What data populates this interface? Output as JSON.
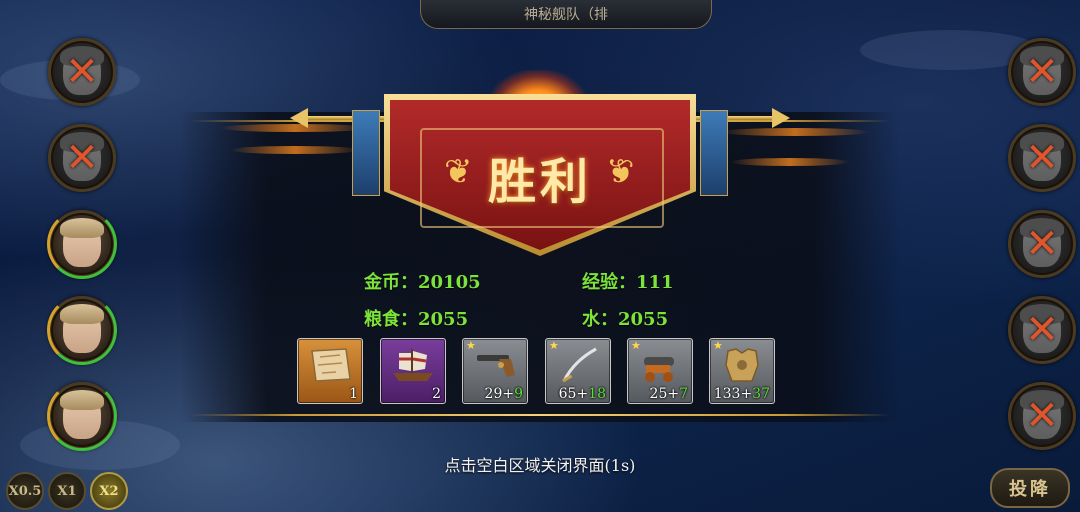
{
  "header": {
    "title": "神秘舰队（排"
  },
  "left_fleet": [
    {
      "status": "defeated",
      "mark": "✕"
    },
    {
      "status": "defeated",
      "mark": "✕"
    },
    {
      "status": "alive",
      "mark": ""
    },
    {
      "status": "alive",
      "mark": ""
    },
    {
      "status": "alive",
      "mark": ""
    }
  ],
  "right_fleet": [
    {
      "status": "defeated",
      "mark": "✕"
    },
    {
      "status": "defeated",
      "mark": "✕"
    },
    {
      "status": "defeated",
      "mark": "✕"
    },
    {
      "status": "defeated",
      "mark": "✕"
    },
    {
      "status": "defeated",
      "mark": "✕"
    }
  ],
  "result": {
    "title": "胜利",
    "laurel_left": "❦",
    "laurel_right": "❦",
    "stats": {
      "gold": "金币：20105",
      "exp": "经验：111",
      "food": "粮食：2055",
      "water": "水：2055"
    }
  },
  "rewards": [
    {
      "icon": "treasure-map-icon",
      "star": "",
      "qty": "1",
      "plus": ""
    },
    {
      "icon": "ship-icon",
      "star": "",
      "qty": "2",
      "plus": ""
    },
    {
      "icon": "pistol-icon",
      "star": "★",
      "qty": "29+",
      "plus": "9"
    },
    {
      "icon": "sabre-icon",
      "star": "★",
      "qty": "65+",
      "plus": "18"
    },
    {
      "icon": "cannon-icon",
      "star": "★",
      "qty": "25+",
      "plus": "7"
    },
    {
      "icon": "armor-icon",
      "star": "★",
      "qty": "133+",
      "plus": "37"
    }
  ],
  "hint": "点击空白区域关闭界面(1s)",
  "controls": {
    "speed_05": "X0.5",
    "speed_1": "X1",
    "speed_2": "X2",
    "active_speed": "X2",
    "surrender": "投降"
  },
  "colors": {
    "stat_green": "#7be33a",
    "banner_red": "#b22a2a",
    "gold_trim": "#f3d27a",
    "defeated_mark": "#e0552a"
  }
}
